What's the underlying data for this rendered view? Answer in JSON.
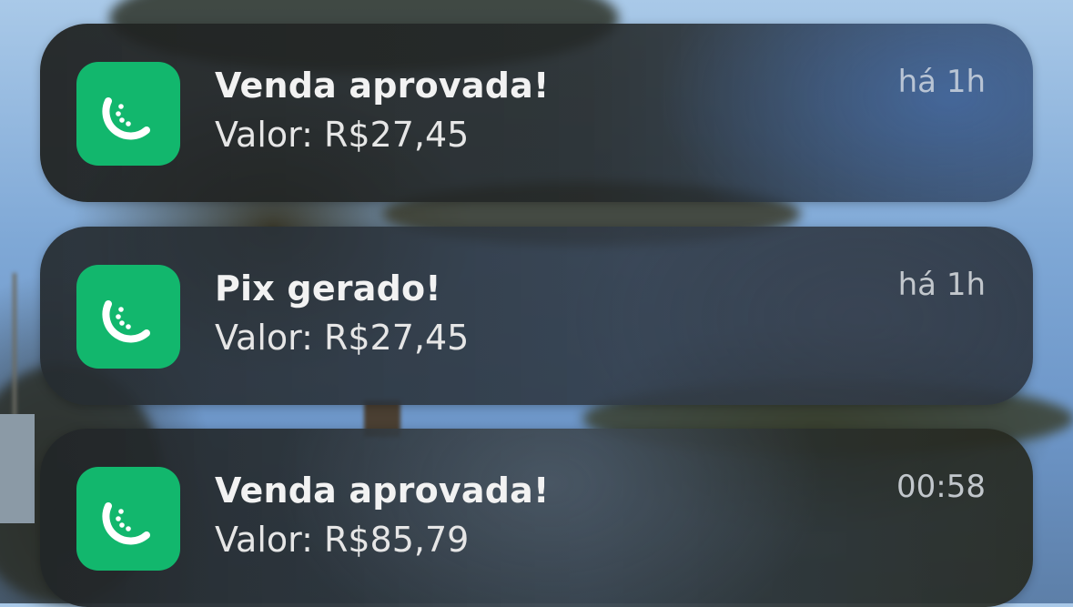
{
  "colors": {
    "app_icon_background": "#12b76d",
    "app_icon_glyph": "#ffffff"
  },
  "notifications": [
    {
      "app_icon": "watermelon-slice-icon",
      "title": "Venda aprovada!",
      "body": "Valor: R$27,45",
      "time": "há 1h"
    },
    {
      "app_icon": "watermelon-slice-icon",
      "title": "Pix gerado!",
      "body": "Valor: R$27,45",
      "time": "há 1h"
    },
    {
      "app_icon": "watermelon-slice-icon",
      "title": "Venda aprovada!",
      "body": "Valor: R$85,79",
      "time": "00:58"
    }
  ]
}
